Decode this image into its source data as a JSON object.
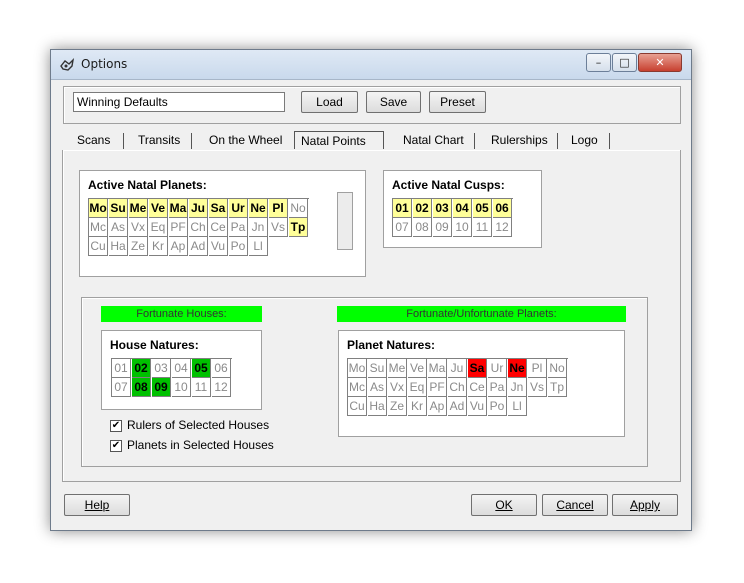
{
  "window": {
    "title": "Options"
  },
  "profile": {
    "name_value": "Winning Defaults",
    "load_label": "Load",
    "save_label": "Save",
    "preset_label": "Preset"
  },
  "tabs": [
    "Scans",
    "Transits",
    "On the Wheel",
    "Natal Points",
    "Natal Chart",
    "Rulerships",
    "Logo"
  ],
  "active_tab": "Natal Points",
  "natal_planets": {
    "title": "Active Natal Planets:",
    "rows": [
      [
        {
          "t": "Mo",
          "on": true
        },
        {
          "t": "Su",
          "on": true
        },
        {
          "t": "Me",
          "on": true
        },
        {
          "t": "Ve",
          "on": true
        },
        {
          "t": "Ma",
          "on": true
        },
        {
          "t": "Ju",
          "on": true
        },
        {
          "t": "Sa",
          "on": true
        },
        {
          "t": "Ur",
          "on": true
        },
        {
          "t": "Ne",
          "on": true
        },
        {
          "t": "Pl",
          "on": true
        },
        {
          "t": "No",
          "on": false
        }
      ],
      [
        {
          "t": "Mc",
          "on": false
        },
        {
          "t": "As",
          "on": false
        },
        {
          "t": "Vx",
          "on": false
        },
        {
          "t": "Eq",
          "on": false
        },
        {
          "t": "PF",
          "on": false
        },
        {
          "t": "Ch",
          "on": false
        },
        {
          "t": "Ce",
          "on": false
        },
        {
          "t": "Pa",
          "on": false
        },
        {
          "t": "Jn",
          "on": false
        },
        {
          "t": "Vs",
          "on": false
        },
        {
          "t": "Tp",
          "on": true
        }
      ],
      [
        {
          "t": "Cu",
          "on": false
        },
        {
          "t": "Ha",
          "on": false
        },
        {
          "t": "Ze",
          "on": false
        },
        {
          "t": "Kr",
          "on": false
        },
        {
          "t": "Ap",
          "on": false
        },
        {
          "t": "Ad",
          "on": false
        },
        {
          "t": "Vu",
          "on": false
        },
        {
          "t": "Po",
          "on": false
        },
        {
          "t": "Ll",
          "on": false
        }
      ]
    ]
  },
  "natal_cusps": {
    "title": "Active Natal Cusps:",
    "rows": [
      [
        {
          "t": "01",
          "on": true
        },
        {
          "t": "02",
          "on": true
        },
        {
          "t": "03",
          "on": true
        },
        {
          "t": "04",
          "on": true
        },
        {
          "t": "05",
          "on": true
        },
        {
          "t": "06",
          "on": true
        }
      ],
      [
        {
          "t": "07",
          "on": false
        },
        {
          "t": "08",
          "on": false
        },
        {
          "t": "09",
          "on": false
        },
        {
          "t": "10",
          "on": false
        },
        {
          "t": "11",
          "on": false
        },
        {
          "t": "12",
          "on": false
        }
      ]
    ]
  },
  "fortunate_houses": {
    "bar_label": "Fortunate Houses:",
    "title": "House Natures:",
    "rows": [
      [
        {
          "t": "01",
          "s": "off"
        },
        {
          "t": "02",
          "s": "green"
        },
        {
          "t": "03",
          "s": "off"
        },
        {
          "t": "04",
          "s": "off"
        },
        {
          "t": "05",
          "s": "green"
        },
        {
          "t": "06",
          "s": "off"
        }
      ],
      [
        {
          "t": "07",
          "s": "off"
        },
        {
          "t": "08",
          "s": "green"
        },
        {
          "t": "09",
          "s": "green"
        },
        {
          "t": "10",
          "s": "off"
        },
        {
          "t": "11",
          "s": "off"
        },
        {
          "t": "12",
          "s": "off"
        }
      ]
    ],
    "check_rulers": {
      "label": "Rulers of Selected Houses",
      "checked": true
    },
    "check_planets": {
      "label": "Planets in Selected Houses",
      "checked": true
    }
  },
  "planet_natures": {
    "bar_label": "Fortunate/Unfortunate Planets:",
    "title": "Planet Natures:",
    "rows": [
      [
        {
          "t": "Mo",
          "s": "off"
        },
        {
          "t": "Su",
          "s": "off"
        },
        {
          "t": "Me",
          "s": "off"
        },
        {
          "t": "Ve",
          "s": "off"
        },
        {
          "t": "Ma",
          "s": "off"
        },
        {
          "t": "Ju",
          "s": "off"
        },
        {
          "t": "Sa",
          "s": "red"
        },
        {
          "t": "Ur",
          "s": "off"
        },
        {
          "t": "Ne",
          "s": "red"
        },
        {
          "t": "Pl",
          "s": "off"
        },
        {
          "t": "No",
          "s": "off"
        }
      ],
      [
        {
          "t": "Mc",
          "s": "off"
        },
        {
          "t": "As",
          "s": "off"
        },
        {
          "t": "Vx",
          "s": "off"
        },
        {
          "t": "Eq",
          "s": "off"
        },
        {
          "t": "PF",
          "s": "off"
        },
        {
          "t": "Ch",
          "s": "off"
        },
        {
          "t": "Ce",
          "s": "off"
        },
        {
          "t": "Pa",
          "s": "off"
        },
        {
          "t": "Jn",
          "s": "off"
        },
        {
          "t": "Vs",
          "s": "off"
        },
        {
          "t": "Tp",
          "s": "off"
        }
      ],
      [
        {
          "t": "Cu",
          "s": "off"
        },
        {
          "t": "Ha",
          "s": "off"
        },
        {
          "t": "Ze",
          "s": "off"
        },
        {
          "t": "Kr",
          "s": "off"
        },
        {
          "t": "Ap",
          "s": "off"
        },
        {
          "t": "Ad",
          "s": "off"
        },
        {
          "t": "Vu",
          "s": "off"
        },
        {
          "t": "Po",
          "s": "off"
        },
        {
          "t": "Ll",
          "s": "off"
        }
      ]
    ]
  },
  "footer": {
    "help_label": "Help",
    "ok_label": "OK",
    "cancel_label": "Cancel",
    "apply_label": "Apply"
  },
  "colors": {
    "selected_yellow": "#ffff99",
    "fortunate_green": "#00c000",
    "unfortunate_red": "#ff0000",
    "bar_green": "#00ff00"
  }
}
